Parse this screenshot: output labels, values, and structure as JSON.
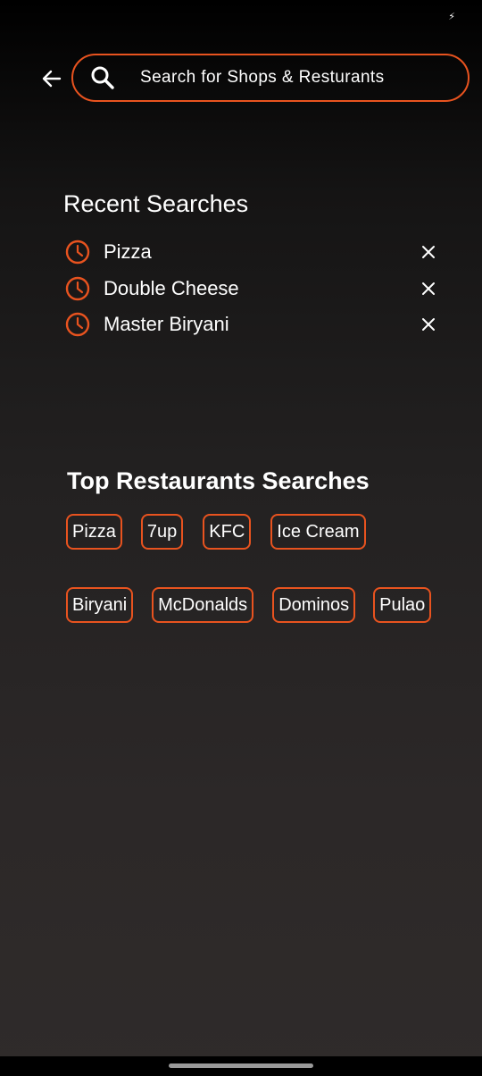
{
  "status_bar": {
    "icon": "bolt-icon"
  },
  "search": {
    "placeholder": "Search for Shops & Resturants",
    "value": "",
    "accent": "#e8531f"
  },
  "recent": {
    "title": "Recent Searches",
    "items": [
      {
        "label": "Pizza"
      },
      {
        "label": "Double Cheese"
      },
      {
        "label": "Master Biryani"
      }
    ]
  },
  "top": {
    "title": "Top Restaurants Searches",
    "row1": [
      "Pizza",
      "7up",
      "KFC",
      "Ice Cream"
    ],
    "row2": [
      "Biryani",
      "McDonalds",
      "Dominos",
      "Pulao"
    ]
  },
  "colors": {
    "accent": "#e8531f",
    "text": "#ffffff",
    "background_top": "#000000",
    "background_bottom": "#2f2b2a"
  }
}
